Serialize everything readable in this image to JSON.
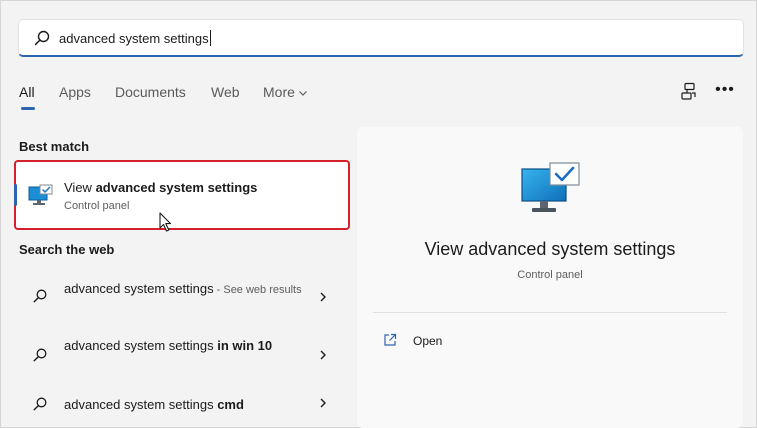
{
  "search": {
    "value": "advanced system settings",
    "icon": "search-icon"
  },
  "tabs": [
    {
      "label": "All"
    },
    {
      "label": "Apps"
    },
    {
      "label": "Documents"
    },
    {
      "label": "Web"
    },
    {
      "label": "More"
    }
  ],
  "best_match": {
    "section_label": "Best match",
    "title_prefix": "View ",
    "title_bold": "advanced system settings",
    "subtitle": "Control panel",
    "icon": "monitor-check-icon"
  },
  "web": {
    "section_label": "Search the web",
    "items": [
      {
        "text": "advanced system settings",
        "bold": "",
        "hint": " - See web results"
      },
      {
        "text": "advanced system settings ",
        "bold": "in win 10",
        "hint": ""
      },
      {
        "text": "advanced system settings ",
        "bold": "cmd",
        "hint": ""
      }
    ]
  },
  "detail": {
    "title": "View advanced system settings",
    "subtitle": "Control panel",
    "action_open": "Open"
  },
  "colors": {
    "accent": "#2d64b0",
    "highlight_border": "#d4202a"
  }
}
